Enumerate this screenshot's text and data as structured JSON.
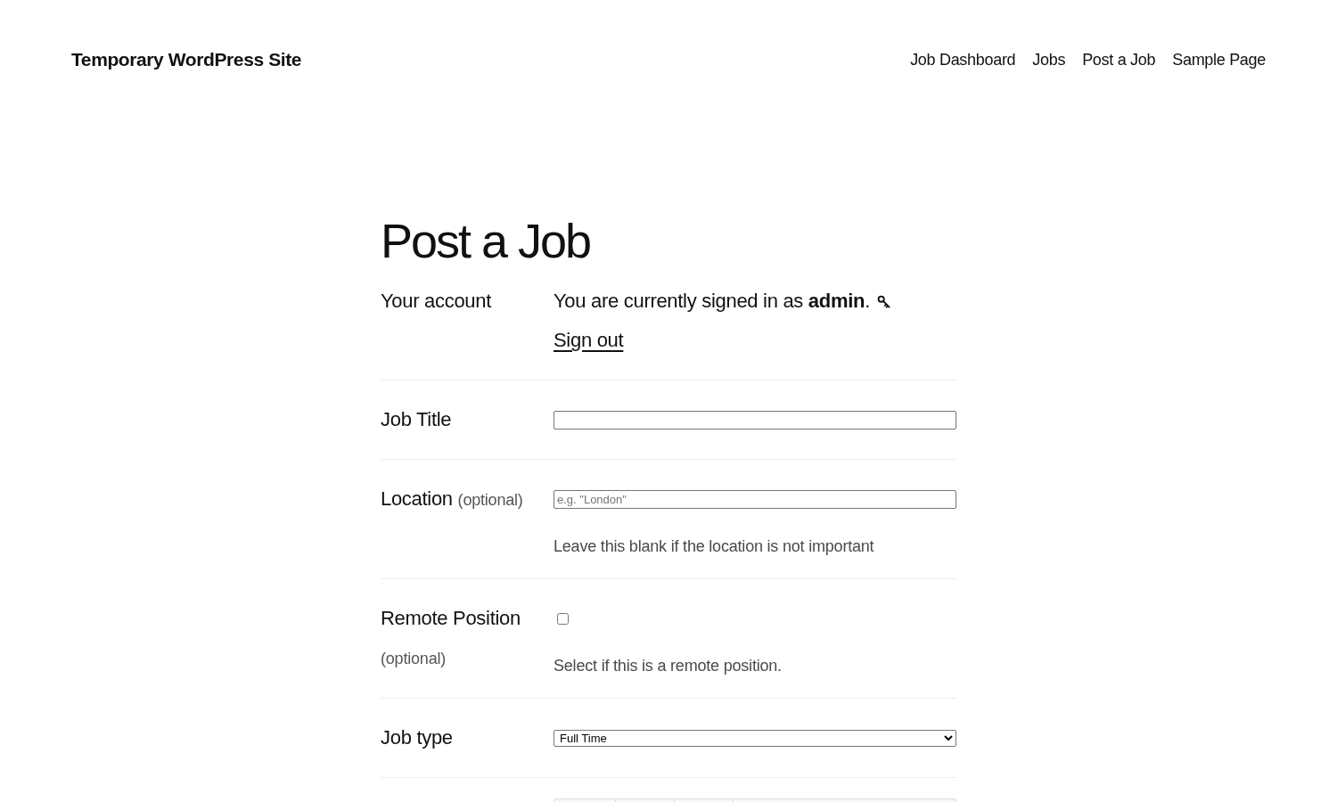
{
  "site_title": "Temporary WordPress Site",
  "nav": [
    {
      "label": "Job Dashboard"
    },
    {
      "label": "Jobs"
    },
    {
      "label": "Post a Job"
    },
    {
      "label": "Sample Page"
    }
  ],
  "page_title": "Post a Job",
  "form": {
    "rows": [
      {
        "kind": "account",
        "label": "Your account",
        "text": "You are currently signed in as **admin**.",
        "link": "Sign out"
      },
      {
        "kind": "text",
        "label": "Job Title"
      },
      {
        "kind": "text",
        "label": "Location",
        "optional": "(optional)",
        "placeholder": "e.g. \"London\"",
        "description": "Leave this blank if the location is not important"
      },
      {
        "kind": "checkbox",
        "label": "Remote Position",
        "optional": "(optional)",
        "checked": false,
        "description": "Select if this is a remote position."
      },
      {
        "kind": "select",
        "label": "Job type",
        "value": "Full Time"
      },
      {
        "kind": "editor"
      }
    ]
  }
}
